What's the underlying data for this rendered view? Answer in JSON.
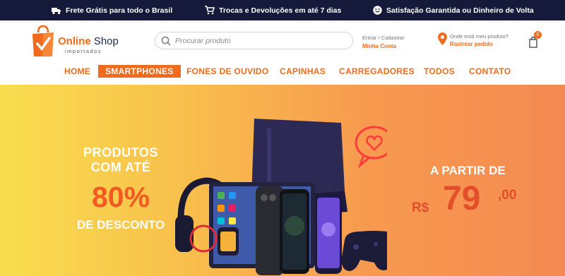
{
  "topbar": {
    "items": [
      {
        "icon": "truck-icon",
        "text": "Frete Grátis para todo o Brasil"
      },
      {
        "icon": "cart-icon",
        "text": "Trocas e Devoluções em até 7 dias"
      },
      {
        "icon": "smile-icon",
        "text": "Satisfação Garantida ou Dinheiro de Volta"
      }
    ]
  },
  "logo": {
    "name_bold": "Online",
    "name_rest": " Shop",
    "tagline": "importados"
  },
  "search": {
    "placeholder": "Procurar produto"
  },
  "account": {
    "line1": "Entrar / Cadastrar",
    "link": "Minha Conta"
  },
  "track": {
    "line1": "Onde está meu produto?",
    "link": "Rastrear pedido"
  },
  "cart": {
    "count": "0"
  },
  "nav": {
    "items": [
      "HOME",
      "SMARTPHONES",
      "FONES DE OUVIDO",
      "CAPINHAS",
      "CARREGADORES",
      "TODOS",
      "CONTATO"
    ],
    "active_index": 1
  },
  "hero": {
    "left_line1": "PRODUTOS",
    "left_line2": "COM ATÉ",
    "percent": "80%",
    "left_line3": "DE DESCONTO",
    "from": "A PARTIR DE",
    "currency": "R$",
    "price": "79",
    "cents": ",00"
  },
  "colors": {
    "accent": "#f26a1b",
    "topbar": "#161a3a",
    "price": "#e24f2a"
  }
}
